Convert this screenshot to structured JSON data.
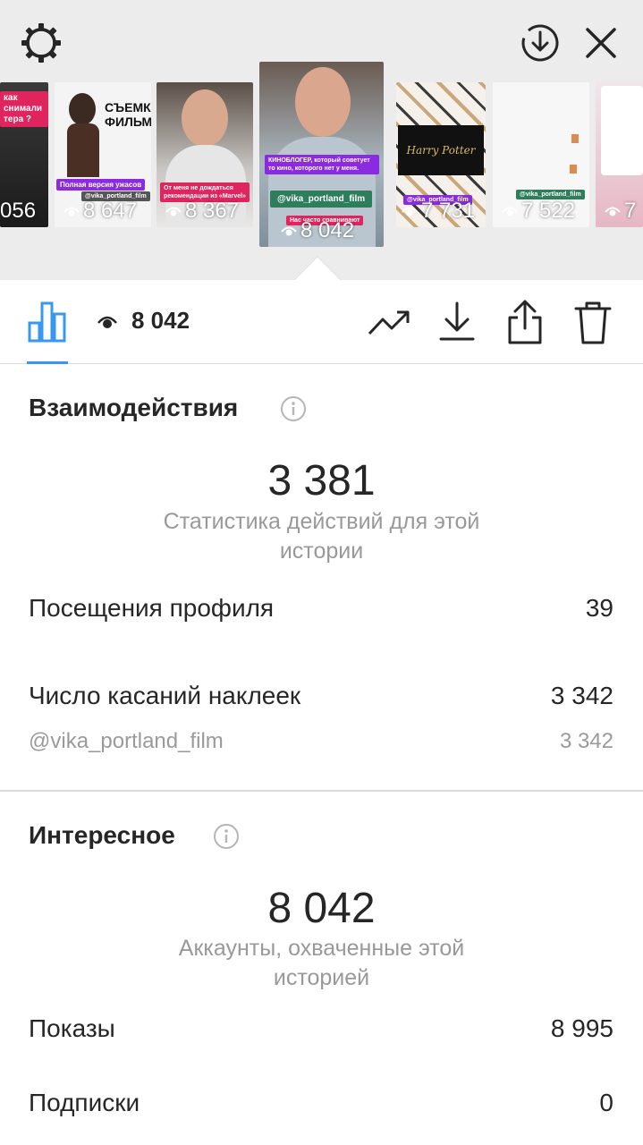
{
  "stories": [
    {
      "views": "056",
      "caption": "как снимали\nтера ?"
    },
    {
      "views": "8 647",
      "caption": "СЪЕМКИ\nФИЛЬМА",
      "tag": "Полная версия ужасов",
      "handle": "@vika_portland_film"
    },
    {
      "views": "8 367",
      "caption": "От меня не дождаться рекомендации из «Marvel»"
    },
    {
      "views": "8 042",
      "caption": "КИНОБЛОГЕР, который советует то кино, которого нет у меня.",
      "handle": "@vika_portland_film",
      "tag": "Нас часто сравнивают"
    },
    {
      "views": "7 731",
      "caption": "Harry Potter",
      "handle": "@vika_portland_film"
    },
    {
      "views": "7 522",
      "handle": "@vika_portland_film"
    },
    {
      "views": "7",
      "caption": ""
    }
  ],
  "toolbar": {
    "views": "8 042"
  },
  "interactions": {
    "title": "Взаимодействия",
    "total": "3 381",
    "subtitle": "Статистика действий для этой истории",
    "profile_visits_label": "Посещения профиля",
    "profile_visits_value": "39",
    "sticker_taps_label": "Число касаний наклеек",
    "sticker_taps_value": "3 342",
    "sticker_handle": "@vika_portland_film",
    "sticker_handle_value": "3 342"
  },
  "discovery": {
    "title": "Интересное",
    "total": "8 042",
    "subtitle": "Аккаунты, охваченные этой историей",
    "impressions_label": "Показы",
    "impressions_value": "8 995",
    "follows_label": "Подписки",
    "follows_value": "0"
  },
  "colors": {
    "accent": "#3897f0",
    "top_bg": "#ececec",
    "text": "#262626",
    "muted": "#999999"
  },
  "icons": [
    "gear-icon",
    "download-circle-icon",
    "close-icon",
    "bar-chart-icon",
    "eye-icon",
    "trend-icon",
    "download-icon",
    "share-icon",
    "trash-icon",
    "info-icon"
  ]
}
